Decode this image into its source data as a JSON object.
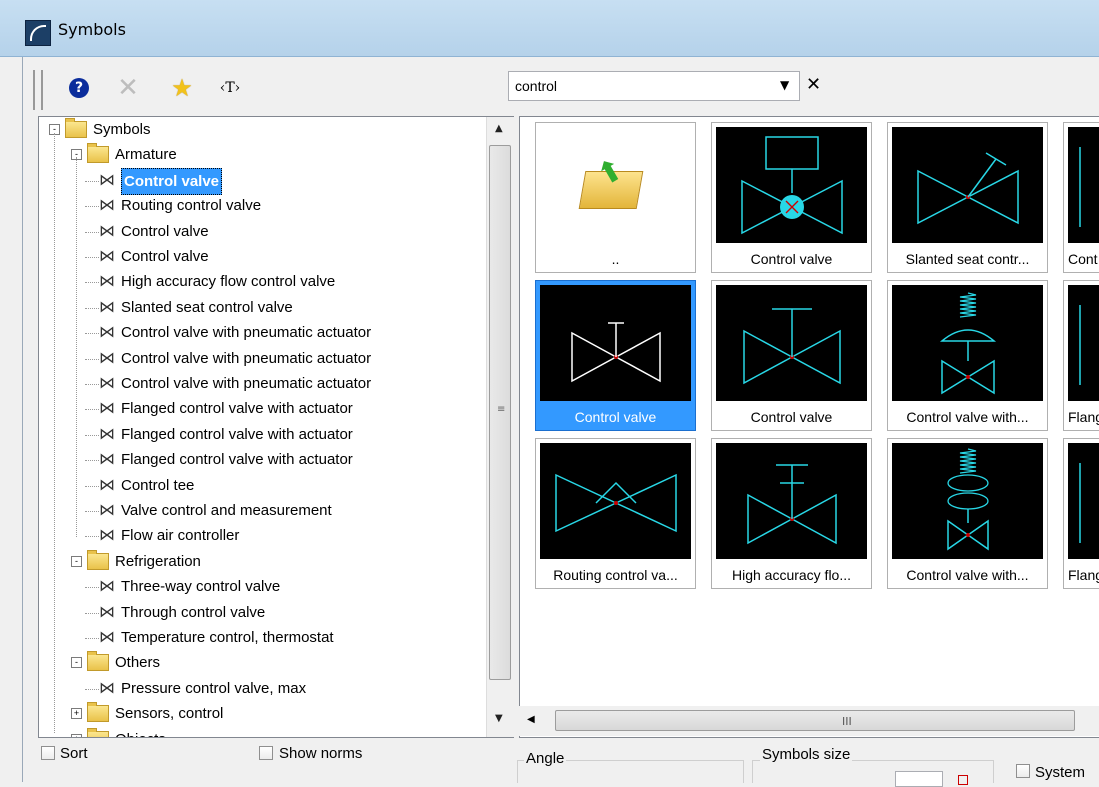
{
  "window": {
    "title": "Symbols"
  },
  "toolbar": {
    "tag_label": "‹T›"
  },
  "search": {
    "value": "control",
    "placeholder": ""
  },
  "tree": {
    "root": "Symbols",
    "groups": [
      {
        "label": "Armature",
        "items": [
          "Control valve",
          "Routing control valve",
          "Control valve",
          "Control valve",
          "High accuracy flow control valve",
          "Slanted seat control valve",
          "Control valve with pneumatic actuator",
          "Control valve with pneumatic actuator",
          "Control valve with pneumatic actuator",
          "Flanged control valve with actuator",
          "Flanged control valve with actuator",
          "Flanged control valve with actuator",
          "Control tee",
          "Valve control and measurement",
          "Flow air controller"
        ]
      },
      {
        "label": "Refrigeration",
        "items": [
          "Three-way control valve",
          "Through control valve",
          "Temperature control, thermostat"
        ]
      },
      {
        "label": "Others",
        "items": [
          "Pressure control valve, max"
        ]
      },
      {
        "label": "Sensors, control",
        "items": []
      },
      {
        "label": "Objects",
        "items": []
      }
    ]
  },
  "grid": {
    "tiles": [
      {
        "label": "..",
        "kind": "up"
      },
      {
        "label": "Control valve",
        "kind": "cv_box_ball"
      },
      {
        "label": "Slanted seat contr...",
        "kind": "slanted"
      },
      {
        "label": "Cont",
        "kind": "partial"
      },
      {
        "label": "Control valve",
        "kind": "cv_white",
        "selected": true
      },
      {
        "label": "Control valve",
        "kind": "cv_t"
      },
      {
        "label": "Control valve with...",
        "kind": "spring"
      },
      {
        "label": "Flang",
        "kind": "partial"
      },
      {
        "label": "Routing control va...",
        "kind": "routing"
      },
      {
        "label": "High accuracy flo...",
        "kind": "high_acc"
      },
      {
        "label": "Control valve with...",
        "kind": "spring2"
      },
      {
        "label": "Flang",
        "kind": "partial"
      }
    ]
  },
  "bottom": {
    "sort_label": "Sort",
    "show_norms_label": "Show norms",
    "angle_label": "Angle",
    "symbols_size_label": "Symbols size",
    "system_label": "System"
  },
  "colors": {
    "symbol_line": "#28d7e6",
    "selection": "#3399ff"
  }
}
